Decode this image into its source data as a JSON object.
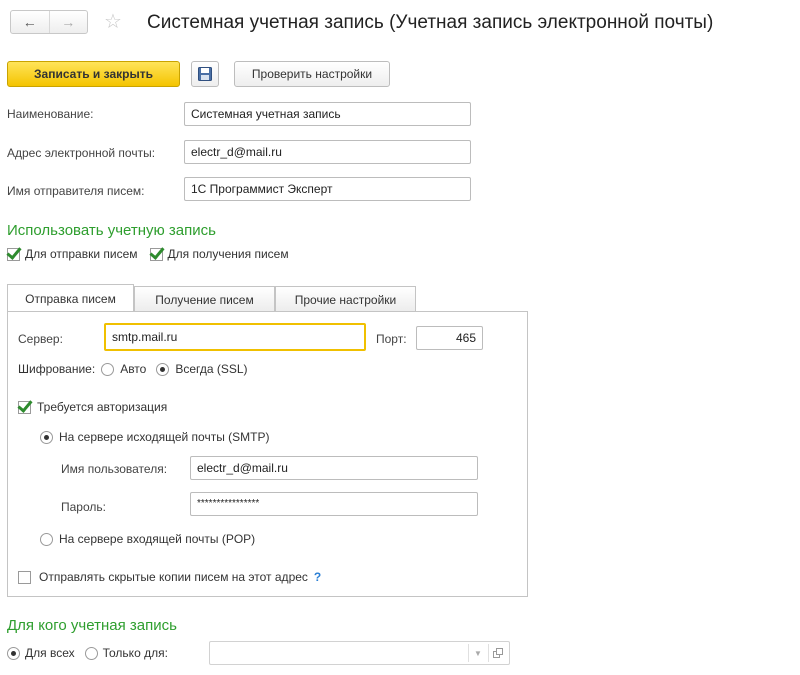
{
  "window": {
    "title": "Системная учетная запись (Учетная запись электронной почты)",
    "back_icon": "←",
    "forward_icon": "→",
    "star_icon": "☆"
  },
  "toolbar": {
    "write_close_label": "Записать и закрыть",
    "save_icon": "floppy-disk-icon",
    "check_settings_label": "Проверить настройки"
  },
  "form": {
    "name_label": "Наименование:",
    "name_value": "Системная учетная запись",
    "email_label": "Адрес электронной почты:",
    "email_value": "electr_d@mail.ru",
    "sender_label": "Имя отправителя писем:",
    "sender_value": "1С Программист Эксперт"
  },
  "use_account": {
    "title": "Использовать учетную запись",
    "send_label": "Для отправки писем",
    "send_checked": true,
    "receive_label": "Для получения писем",
    "receive_checked": true
  },
  "tabs": [
    {
      "label": "Отправка писем",
      "active": true
    },
    {
      "label": "Получение писем",
      "active": false
    },
    {
      "label": "Прочие настройки",
      "active": false
    }
  ],
  "sending": {
    "server_label": "Сервер:",
    "server_value": "smtp.mail.ru",
    "port_label": "Порт:",
    "port_value": "465",
    "encryption_label": "Шифрование:",
    "encryption_auto": "Авто",
    "encryption_always": "Всегда (SSL)",
    "auth_label": "Требуется авторизация",
    "auth_checked": true,
    "smtp_option": "На сервере исходящей почты (SMTP)",
    "username_label": "Имя пользователя:",
    "username_value": "electr_d@mail.ru",
    "password_label": "Пароль:",
    "password_value": "****************",
    "pop_option": "На сервере входящей почты (POP)",
    "bcc_label": "Отправлять скрытые копии писем на этот адрес",
    "bcc_checked": false,
    "help_icon": "?"
  },
  "for_whom": {
    "title": "Для кого учетная запись",
    "all_label": "Для всех",
    "only_label": "Только для:",
    "only_value": ""
  },
  "colors": {
    "accent_yellow": "#f4c400",
    "section_green": "#2e9e2e",
    "help_blue": "#2b7fd4"
  }
}
